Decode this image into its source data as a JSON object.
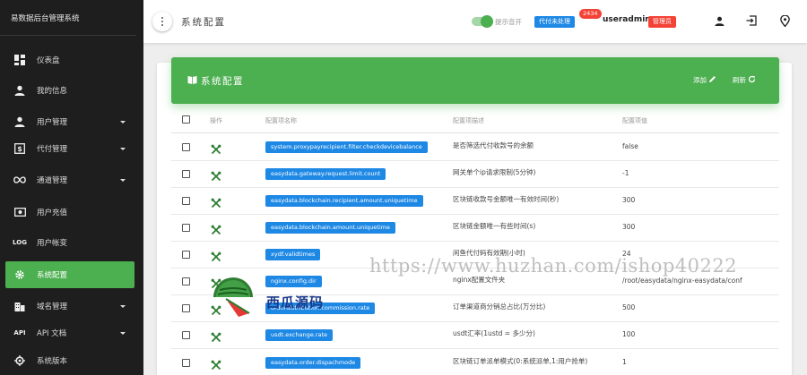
{
  "sidebar": {
    "brand": "易数据后台管理系统",
    "items": [
      {
        "label": "仪表盘",
        "icon": "dashboard-icon",
        "caret": false,
        "active": false
      },
      {
        "label": "我的信息",
        "icon": "person-icon",
        "caret": false,
        "active": false
      },
      {
        "label": "用户管理",
        "icon": "person-icon",
        "caret": true,
        "active": false
      },
      {
        "label": "代付管理",
        "icon": "payment-icon",
        "caret": true,
        "active": false
      },
      {
        "label": "通道管理",
        "icon": "infinity-icon",
        "caret": true,
        "active": false
      },
      {
        "label": "用户充值",
        "icon": "money-icon",
        "caret": false,
        "active": false
      },
      {
        "label": "用户帐变",
        "icon": "log-icon",
        "icon_text": "LOG",
        "caret": false,
        "active": false
      },
      {
        "label": "系统配置",
        "icon": "settings-icon",
        "caret": false,
        "active": true
      },
      {
        "label": "域名管理",
        "icon": "domain-icon",
        "caret": true,
        "active": false
      },
      {
        "label": "API 文档",
        "icon": "api-icon",
        "icon_text": "API",
        "caret": true,
        "active": false
      },
      {
        "label": "系统版本",
        "icon": "version-icon",
        "caret": false,
        "active": false
      }
    ]
  },
  "topbar": {
    "title": "系统配置",
    "toggle_label": "提示音开",
    "toggle_on": true,
    "pending_label": "代付未处理",
    "pending_count": "2434",
    "username": "useradmin",
    "role": "管理员"
  },
  "card": {
    "title": "系统配置",
    "add_label": "添加",
    "refresh_label": "刷新",
    "columns": [
      "操作",
      "配置项名称",
      "配置项描述",
      "配置项值"
    ]
  },
  "rows": [
    {
      "key": "system.proxypayrecipient.filter.checkdevicebalance",
      "desc": "是否筛选代付收款号的余额",
      "value": "false"
    },
    {
      "key": "easydata.gateway.request.limit.count",
      "desc": "网关单个ip请求限制(5分钟)",
      "value": "-1"
    },
    {
      "key": "easydata.blockchain.recipient.amount.uniquetime",
      "desc": "区块链收款号金额唯一有效时间(秒)",
      "value": "300"
    },
    {
      "key": "easydata.blockchain.amount.uniquetime",
      "desc": "区块链金额唯一有些时间(s)",
      "value": "300"
    },
    {
      "key": "xydf.validtimes",
      "desc": "闲鱼代付码有效期(小时)",
      "value": "24"
    },
    {
      "key": "nginx.config.dir",
      "desc": "nginx配置文件夹",
      "value": "/root/easydata/nginx-easydata/conf"
    },
    {
      "key": "orderdistribution.commission.rate",
      "desc": "订单渠道商分销总占比(万分比)",
      "value": "500"
    },
    {
      "key": "usdt.exchange.rate",
      "desc": "usdt汇率(1ustd = 多少分)",
      "value": "100"
    },
    {
      "key": "easydata.order.dispachmode",
      "desc": "区块链订单派单模式(0:系统派单,1:用户抢单)",
      "value": "1"
    }
  ],
  "watermark": {
    "url": "https://www.huzhan.com/ishop40222",
    "logo_text": "西瓜源码"
  },
  "colors": {
    "primary_green": "#4caf50",
    "badge_blue": "#1e88e5",
    "badge_red": "#f44336",
    "sidebar_bg": "#1e1e1e"
  }
}
